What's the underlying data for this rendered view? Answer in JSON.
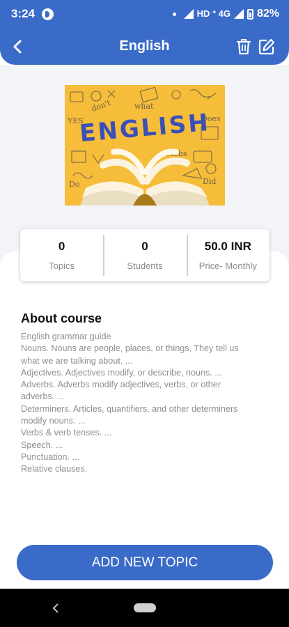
{
  "status_bar": {
    "time": "3:24",
    "network": "HD ᐩ 4G",
    "battery": "82%"
  },
  "app_bar": {
    "title": "English"
  },
  "course": {
    "image_word": "ENGLISH",
    "stats": [
      {
        "value": "0",
        "label": "Topics"
      },
      {
        "value": "0",
        "label": "Students"
      },
      {
        "value": "50.0 INR",
        "label": "Price- Monthly"
      }
    ]
  },
  "about": {
    "title": "About course",
    "lines": [
      "English grammar guide",
      "Nouns. Nouns are people, places, or things, They tell us",
      "what we are talking about. ...",
      "Adjectives. Adjectives modify, or describe, nouns. ...",
      "Adverbs. Adverbs modify adjectives, verbs, or other",
      "adverbs. ...",
      "Determiners. Articles, quantifiers, and other determiners",
      "modify nouns. ...",
      "Verbs & verb tenses. ...",
      "Speech. ...",
      "Punctuation. ...",
      "Relative clauses."
    ]
  },
  "actions": {
    "add_topic_label": "ADD NEW TOPIC"
  },
  "icons": {
    "back": "back-arrow-icon",
    "delete": "trash-icon",
    "edit": "edit-icon"
  },
  "colors": {
    "primary": "#3a6bc9",
    "image_background": "#f6bd3a",
    "page_background": "#f3f4f8"
  }
}
